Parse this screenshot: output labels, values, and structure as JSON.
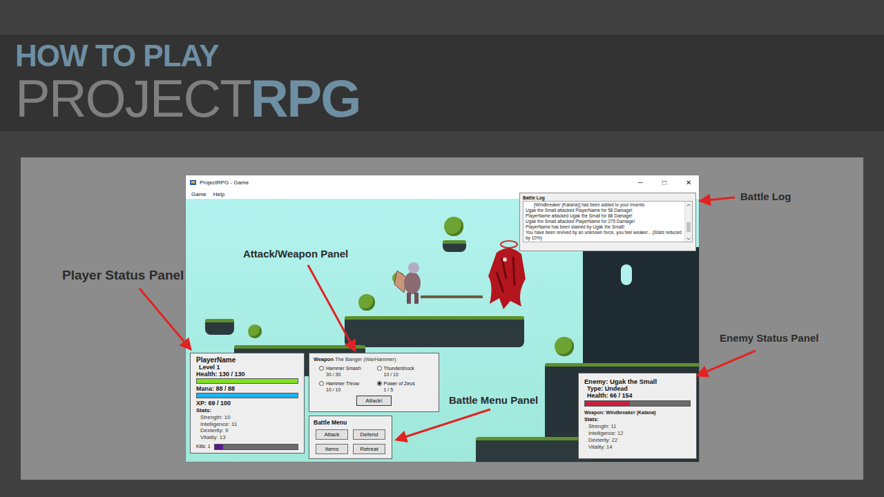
{
  "header": {
    "line1": "HOW TO PLAY",
    "brand_light": "PROJECT",
    "brand_bold": "RPG"
  },
  "annotations": [
    {
      "label": "Battle Log"
    },
    {
      "label": "Player Status Panel"
    },
    {
      "label": "Attack/Weapon Panel"
    },
    {
      "label": "Battle Menu Panel"
    },
    {
      "label": "Enemy Status Panel"
    }
  ],
  "window": {
    "title": "ProjectRPG - Game",
    "controls": [
      "─",
      "□",
      "✕"
    ]
  },
  "menu": [
    "Game",
    "Help"
  ],
  "battle_log": {
    "title": "Battle Log",
    "lines": [
      "[Windbreaker (Katana)] has been added to your Invento",
      "Ugak the Small attacked PlayerName for 58 Damage!",
      "PlayerName attacked Ugak the Small for 88 Damage!",
      "Ugak the Small attacked PlayerName for 275 Damage!",
      "PlayerName has been slained by Ugak the Small!",
      "You have been revived by an unknown force, you feel weaker... (Stats reduced by 10%)"
    ],
    "scroll_level": 0.8
  },
  "player": {
    "name": "PlayerName",
    "level": "Level 1",
    "health": "Health: 130 / 130",
    "health_level": 1,
    "mana": "Mana: 88 / 88",
    "mana_level": 1,
    "xp": "XP: 69 / 100",
    "stats_title": "Stats:",
    "stats": [
      "Strength: 10",
      "Intelligence: 11",
      "Dexterity: 9",
      "Vitality: 13"
    ],
    "kills": "Kills: 1",
    "kills_level": 0.1
  },
  "weapon_panel": {
    "label": "Weapon",
    "name": "The Banger (WarHammer)",
    "attacks": [
      {
        "name": "Hammer Smash",
        "uses": "30 / 30",
        "selected": false
      },
      {
        "name": "Thundershock",
        "uses": "10 / 10",
        "selected": false
      },
      {
        "name": "Hammer Throw",
        "uses": "10 / 10",
        "selected": false
      },
      {
        "name": "Power of Zeus",
        "uses": "1 / 5",
        "selected": true
      }
    ],
    "button": "Attack!"
  },
  "battle_menu": {
    "title": "Battle Menu",
    "buttons": [
      "Attack",
      "Defend",
      "Items",
      "Retreat"
    ]
  },
  "enemy": {
    "name": "Enemy: Ugak the Small",
    "type": "Type: Undead",
    "health": "Health: 66 / 154",
    "health_level": 0.43,
    "weapon": "Weapon: Windbreaker (Katana)",
    "stats_title": "Stats:",
    "stats": [
      "Strength: 11",
      "Intelligence: 12",
      "Dexterity: 22",
      "Vitality: 14"
    ]
  }
}
